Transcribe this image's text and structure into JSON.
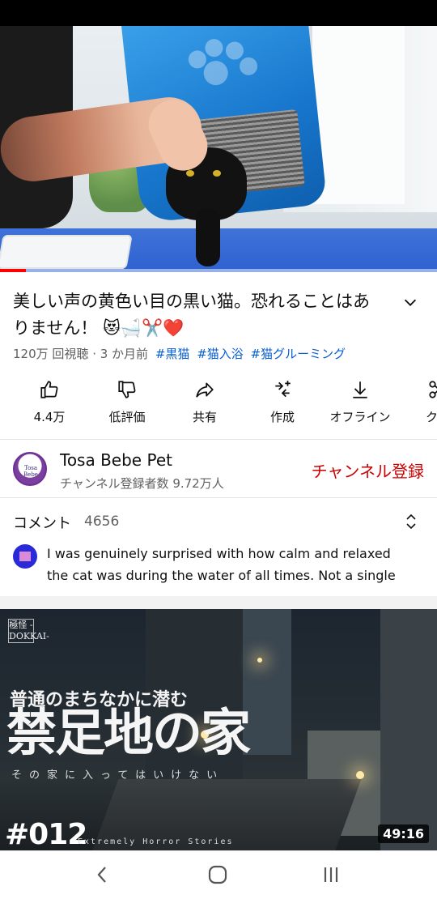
{
  "video": {
    "title": "美しい声の黄色い目の黒い猫。恐れることはありません！ 😻🛁✂️❤️",
    "views": "120万 回視聴",
    "age": "3 か月前",
    "hashtags": [
      "#黒猫",
      "#猫入浴",
      "#猫グルーミング"
    ],
    "progress_fraction": 0.06
  },
  "actions": [
    {
      "icon": "thumbs-up-icon",
      "label": "4.4万"
    },
    {
      "icon": "thumbs-down-icon",
      "label": "低評価"
    },
    {
      "icon": "share-icon",
      "label": "共有"
    },
    {
      "icon": "remix-icon",
      "label": "作成"
    },
    {
      "icon": "download-icon",
      "label": "オフライン"
    },
    {
      "icon": "clip-icon",
      "label": "クリ"
    }
  ],
  "channel": {
    "avatar_text": "Tosa Bebe",
    "name": "Tosa Bebe Pet",
    "subscribers": "チャンネル登録者数 9.72万人",
    "subscribe_label": "チャンネル登録"
  },
  "comments": {
    "heading": "コメント",
    "count": "4656",
    "top_comment": "I was genuinely surprised with how calm and relaxed the cat was during the water of all times. Not a single act of..."
  },
  "next_video": {
    "badge": "極怪 -DOKKAI-",
    "subtitle": "普通のまちなかに潜む",
    "title": "禁足地の家",
    "tagline": "その家に入ってはいけない",
    "episode": "#012",
    "series": "Extremely Horror Stories",
    "duration": "49:16"
  },
  "colors": {
    "accent_blue": "#065fd4",
    "subscribe_red": "#cc0000",
    "progress_red": "#ff0000"
  }
}
